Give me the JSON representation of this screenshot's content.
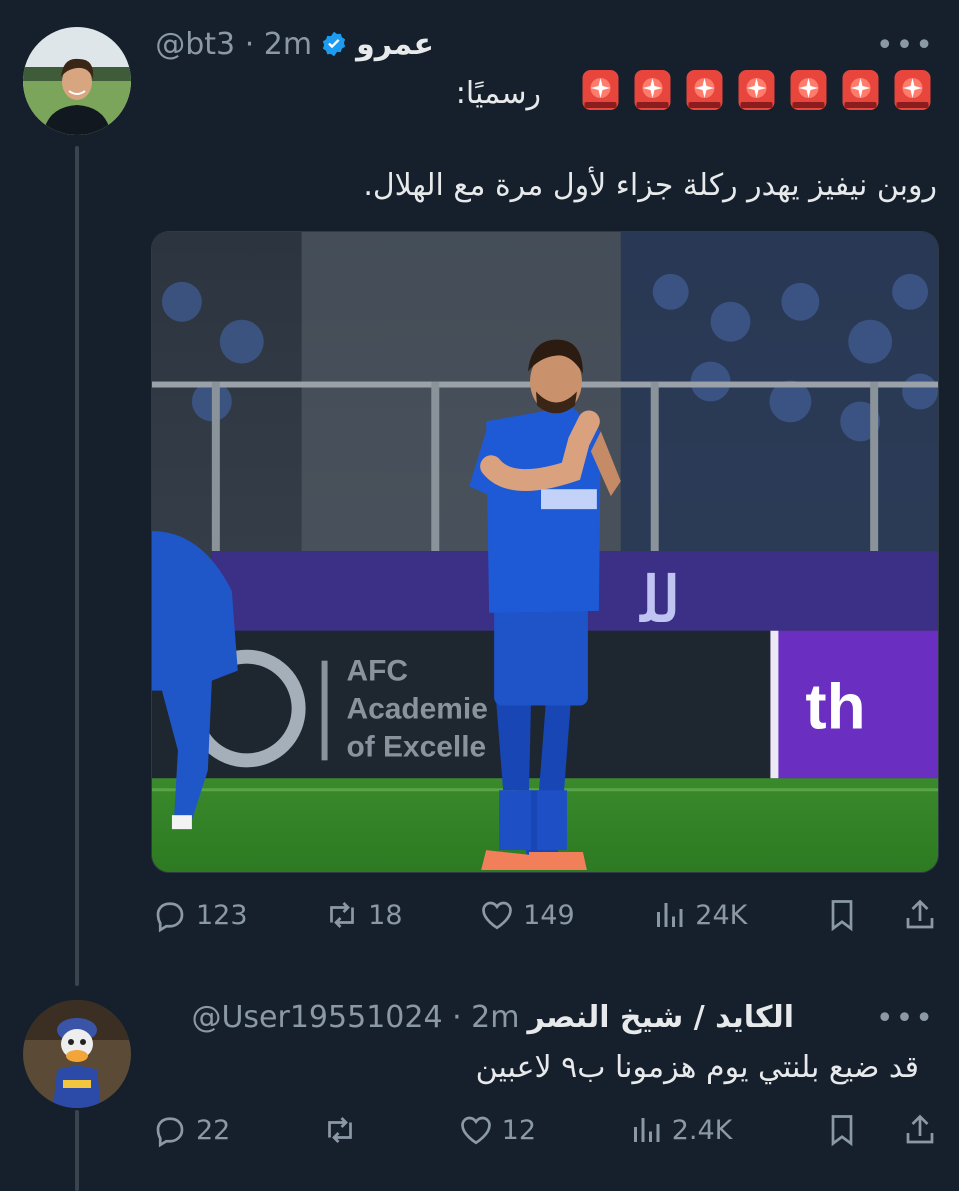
{
  "tweet1": {
    "display_name": "عمرو",
    "handle": "@bt3",
    "time": "2m",
    "more_label": "•••",
    "line1": "رسميًا:",
    "siren_count": 7,
    "line2": "روبن نيفيز يهدر ركلة جزاء لأول مرة مع الهلال.",
    "replies": "123",
    "retweets": "18",
    "likes": "149",
    "views": "24K",
    "media_signage": {
      "board_left": "AFC Academie ntre of Excelle ce",
      "board_right": "the"
    }
  },
  "tweet2": {
    "display_name": "الكايد / شيخ النصر",
    "handle": "@User19551024",
    "time": "2m",
    "more_label": "•••",
    "text": "قد ضيع بلنتي يوم هزمونا ب٩ لاعبين",
    "replies": "22",
    "retweets": "",
    "likes": "12",
    "views": "2.4K"
  },
  "colors": {
    "background": "#16202c",
    "verified": "#1d9bf0",
    "muted": "#8b98a5",
    "thread_line": "#3a444f"
  },
  "icons": [
    "reply-icon",
    "retweet-icon",
    "like-icon",
    "views-icon",
    "bookmark-icon",
    "share-icon",
    "verified-icon",
    "siren-icon"
  ]
}
